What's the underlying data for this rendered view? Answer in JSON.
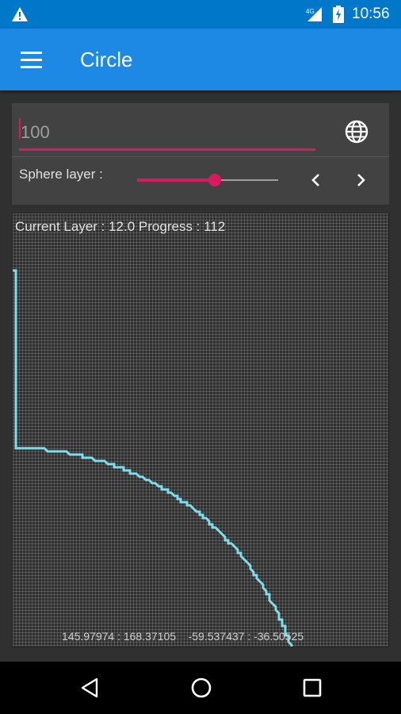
{
  "status_bar": {
    "time": "10:56",
    "icons": [
      "warning-icon",
      "signal-icon",
      "battery-charging-icon"
    ]
  },
  "app_bar": {
    "title": "Circle",
    "menu_icon": "hamburger-menu-icon"
  },
  "controls": {
    "radius_input": {
      "value": "100",
      "placeholder": ""
    },
    "globe_icon": "globe-icon",
    "sphere_layer_label": "Sphere layer :",
    "sphere_layer_slider": {
      "value_fraction": 0.55
    },
    "prev_icon": "chevron-left-icon",
    "next_icon": "chevron-right-icon"
  },
  "canvas": {
    "info": "Current Layer : 12.0 Progress : 112",
    "coordinates": "145.97974 : 168.37105    -59.537437 : -36.50525",
    "stroke_color": "#80deea",
    "accent_color": "#d81b60"
  },
  "nav_bar": {
    "icons": [
      "back-triangle-icon",
      "home-circle-icon",
      "recents-square-icon"
    ]
  }
}
